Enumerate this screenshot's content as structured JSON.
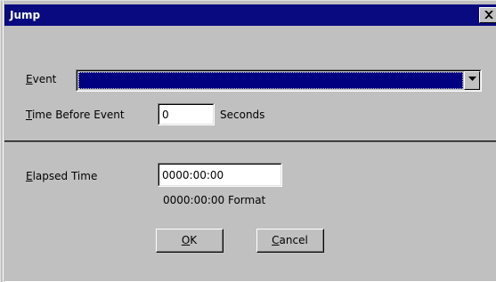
{
  "dialog": {
    "title": "Jump",
    "close_icon": "close-icon"
  },
  "event": {
    "label_mnemonic": "E",
    "label_rest": "vent",
    "selected_value": ""
  },
  "time_before": {
    "label_mnemonic": "T",
    "label_rest": "ime Before Event",
    "value": "0",
    "unit": "Seconds"
  },
  "elapsed": {
    "label_mnemonic": "E",
    "label_rest": "lapsed Time",
    "value": "0000:00:00",
    "format_hint": "0000:00:00 Format"
  },
  "buttons": {
    "ok_mnemonic": "O",
    "ok_rest": "K",
    "cancel_mnemonic": "C",
    "cancel_rest": "ancel"
  },
  "colors": {
    "titlebar": "#0a0a80",
    "face": "#c0c0c0",
    "selection": "#000080"
  }
}
